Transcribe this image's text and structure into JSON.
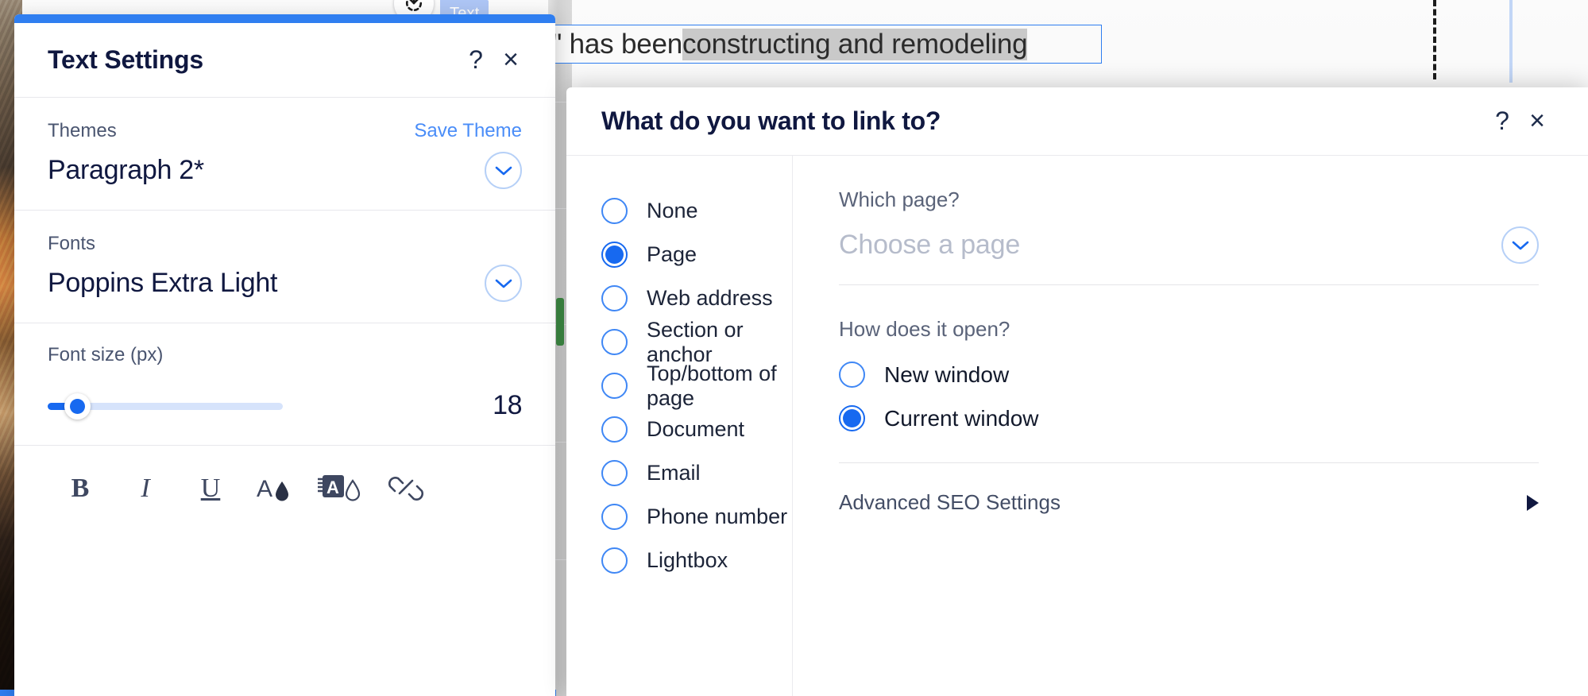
{
  "canvas": {
    "text_element": {
      "tag_label": "Text",
      "content_plain": "\"Wild Bill\" has been ",
      "content_selected": "constructing and remodeling"
    },
    "revert_icon": "revert-icon"
  },
  "text_settings": {
    "title": "Text Settings",
    "help_label": "?",
    "close_label": "×",
    "themes": {
      "label": "Themes",
      "save_label": "Save Theme",
      "value": "Paragraph 2*"
    },
    "fonts": {
      "label": "Fonts",
      "value": "Poppins Extra Light"
    },
    "font_size": {
      "label": "Font size (px)",
      "value": "18",
      "min": 0,
      "max": 100,
      "fill_percent": 12
    },
    "toolbar": [
      {
        "name": "bold-icon",
        "glyph": "B",
        "style": "b"
      },
      {
        "name": "italic-icon",
        "glyph": "I",
        "style": "i"
      },
      {
        "name": "underline-icon",
        "glyph": "U",
        "style": "u"
      },
      {
        "name": "text-color-icon",
        "glyph": "A",
        "style": "color"
      },
      {
        "name": "highlight-color-icon",
        "glyph": "A",
        "style": "highlight"
      },
      {
        "name": "link-icon",
        "glyph": "⚭",
        "style": "link"
      }
    ],
    "accent_color": "#2f7ef0"
  },
  "link_dialog": {
    "title": "What do you want to link to?",
    "help_label": "?",
    "close_label": "×",
    "link_types": [
      {
        "label": "None",
        "selected": false
      },
      {
        "label": "Page",
        "selected": true
      },
      {
        "label": "Web address",
        "selected": false
      },
      {
        "label": "Section or anchor",
        "selected": false
      },
      {
        "label": "Top/bottom of page",
        "selected": false
      },
      {
        "label": "Document",
        "selected": false
      },
      {
        "label": "Email",
        "selected": false
      },
      {
        "label": "Phone number",
        "selected": false
      },
      {
        "label": "Lightbox",
        "selected": false
      }
    ],
    "which_page": {
      "label": "Which page?",
      "placeholder": "Choose a page",
      "value": ""
    },
    "how_open": {
      "label": "How does it open?",
      "options": [
        {
          "label": "New window",
          "selected": false
        },
        {
          "label": "Current window",
          "selected": true
        }
      ]
    },
    "advanced_seo": {
      "label": "Advanced SEO Settings",
      "expanded": false
    },
    "accent_color": "#1769f0"
  }
}
